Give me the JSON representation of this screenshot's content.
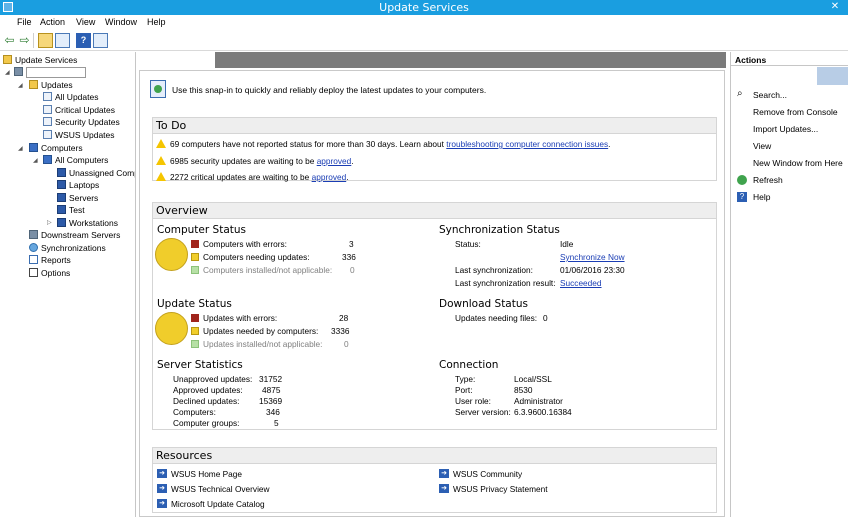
{
  "window": {
    "title": "Update Services",
    "close_glyph": "✕"
  },
  "menu": [
    "File",
    "Action",
    "View",
    "Window",
    "Help"
  ],
  "toolbar": {
    "back_glyph": "⇦",
    "forward_glyph": "⇨",
    "help_glyph": "?"
  },
  "tree": {
    "root": "Update Services",
    "server": "",
    "updates": "Updates",
    "all_updates": "All Updates",
    "critical_updates": "Critical Updates",
    "security_updates": "Security Updates",
    "wsus_updates": "WSUS Updates",
    "computers": "Computers",
    "all_computers": "All Computers",
    "unassigned": "Unassigned Comp",
    "laptops": "Laptops",
    "servers": "Servers",
    "test": "Test",
    "workstations": "Workstations",
    "downstream": "Downstream Servers",
    "synchronizations": "Synchronizations",
    "reports": "Reports",
    "options": "Options"
  },
  "header": {
    "text": "Use this snap-in to quickly and reliably deploy the latest updates to your computers."
  },
  "todo": {
    "title": "To Do",
    "item1_text": "69 computers have not reported status for more than 30 days. Learn about",
    "item1_link": "troubleshooting computer connection issues",
    "item1_suffix": ".",
    "item2_text": "6985 security updates are waiting to be",
    "item2_link": "approved",
    "item2_suffix": ".",
    "item3_text": "2272 critical updates are waiting to be",
    "item3_link": "approved",
    "item3_suffix": "."
  },
  "overview": {
    "title": "Overview",
    "computer_status": {
      "title": "Computer Status",
      "errors_label": "Computers with errors:",
      "errors_value": "3",
      "needing_label": "Computers needing updates:",
      "needing_value": "336",
      "installed_label": "Computers installed/not applicable:",
      "installed_value": "0"
    },
    "update_status": {
      "title": "Update Status",
      "errors_label": "Updates with errors:",
      "errors_value": "28",
      "needed_label": "Updates needed by computers:",
      "needed_value": "3336",
      "installed_label": "Updates installed/not applicable:",
      "installed_value": "0"
    },
    "server_statistics": {
      "title": "Server Statistics",
      "rows": [
        {
          "label": "Unapproved updates:",
          "value": "31752"
        },
        {
          "label": "Approved updates:",
          "value": "4875"
        },
        {
          "label": "Declined updates:",
          "value": "15369"
        },
        {
          "label": "Computers:",
          "value": "346"
        },
        {
          "label": "Computer groups:",
          "value": "5"
        }
      ]
    },
    "sync_status": {
      "title": "Synchronization Status",
      "status_label": "Status:",
      "status_value": "Idle",
      "sync_now": "Synchronize Now",
      "last_sync_label": "Last synchronization:",
      "last_sync_value": "01/06/2016 23:30",
      "last_result_label": "Last synchronization result:",
      "last_result_value": "Succeeded"
    },
    "download_status": {
      "title": "Download Status",
      "needing_label": "Updates needing files:",
      "needing_value": "0"
    },
    "connection": {
      "title": "Connection",
      "rows": [
        {
          "label": "Type:",
          "value": "Local/SSL"
        },
        {
          "label": "Port:",
          "value": "8530"
        },
        {
          "label": "User role:",
          "value": "Administrator"
        },
        {
          "label": "Server version:",
          "value": "6.3.9600.16384"
        }
      ]
    }
  },
  "resources": {
    "title": "Resources",
    "items": [
      "WSUS Home Page",
      "WSUS Technical Overview",
      "Microsoft Update Catalog",
      "WSUS Community",
      "WSUS Privacy Statement"
    ]
  },
  "actions": {
    "title": "Actions",
    "items": [
      "Search...",
      "Remove from Console",
      "Import Updates...",
      "View",
      "New Window from Here",
      "Refresh",
      "Help"
    ]
  }
}
